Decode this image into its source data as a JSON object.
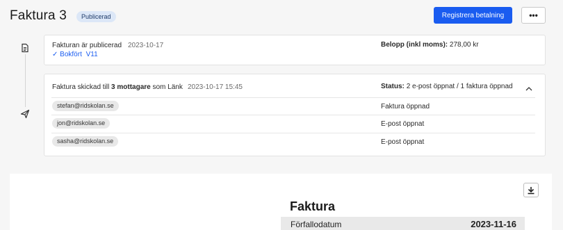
{
  "header": {
    "title": "Faktura 3",
    "status_badge": "Publicerad",
    "primary_action": "Registrera betalning",
    "more_label": "•••"
  },
  "timeline": {
    "icons": [
      "document-icon",
      "send-icon"
    ]
  },
  "publish_event": {
    "text": "Fakturan är publicerad",
    "date": "2023-10-17",
    "bookkeeping_check": "✓",
    "bookkeeping_label": "Bokfört",
    "bookkeeping_ref": "V11",
    "amount_label": "Belopp (inkl moms):",
    "amount_value": "278,00 kr"
  },
  "send_event": {
    "text_prefix": "Faktura skickad till",
    "recipient_count": "3 mottagare",
    "text_suffix": "som Länk",
    "datetime": "2023-10-17 15:45",
    "status_label": "Status:",
    "status_value": "2 e-post öppnat / 1 faktura öppnad",
    "recipients": [
      {
        "email": "stefan@ridskolan.se",
        "status": "Faktura öppnad"
      },
      {
        "email": "jon@ridskolan.se",
        "status": "E-post öppnat"
      },
      {
        "email": "sasha@ridskolan.se",
        "status": "E-post öppnat"
      }
    ]
  },
  "invoice_preview": {
    "title": "Faktura",
    "due_label": "Förfallodatum",
    "due_value": "2023-11-16"
  }
}
